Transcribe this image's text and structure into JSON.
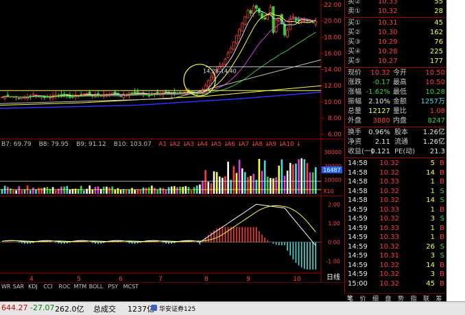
{
  "chart_data": [
    {
      "type": "candlestick",
      "ylim": [
        5.5,
        22.6
      ],
      "y_ticks": [
        "22.00",
        "20.00",
        "18.00",
        "16.00",
        "14.00",
        "12.00",
        "10.00",
        "8.00",
        "6.00"
      ],
      "x_ticks": [
        "4",
        "5",
        "6",
        "7",
        "8",
        "9",
        "10"
      ],
      "annotation": "14.28-14.40"
    },
    {
      "type": "bar",
      "ylim": [
        0,
        32000
      ],
      "y_ticks": [
        "30000",
        "20000",
        "10000"
      ],
      "unit": "X10",
      "current_value": "16487",
      "legend": [
        "B7: 69.79",
        "B8: 79.95",
        "B9: 91.12",
        "B10: 103.07",
        "A1",
        "A2",
        "A3",
        "A4",
        "A5",
        "A6",
        "A7",
        "A8",
        "A9",
        "A10"
      ]
    },
    {
      "type": "line",
      "ylim": [
        -1.6,
        2.3
      ],
      "y_ticks": [
        "2.00",
        "1.00",
        "0.00",
        "-1.00"
      ]
    }
  ],
  "indicator_tabs": [
    "WR",
    "SAR",
    "KDJ",
    "CCI",
    "ROC",
    "MTM",
    "BOLL",
    "PSY",
    "MCST"
  ],
  "period_label": "日线",
  "quote": {
    "sell": [
      {
        "label": "卖②",
        "price": "10.33",
        "vol": "55"
      },
      {
        "label": "卖①",
        "price": "10.32",
        "vol": "28"
      }
    ],
    "buy": [
      {
        "label": "买①",
        "price": "10.31",
        "vol": "45"
      },
      {
        "label": "买②",
        "price": "10.30",
        "vol": "162"
      },
      {
        "label": "买③",
        "price": "10.29",
        "vol": "76"
      },
      {
        "label": "买④",
        "price": "10.28",
        "vol": "225"
      },
      {
        "label": "买⑤",
        "price": "10.27",
        "vol": "177"
      }
    ],
    "stats": [
      {
        "l1": "现价",
        "v1": "10.32",
        "c1": "up",
        "l2": "今开",
        "v2": "10.50",
        "c2": "up"
      },
      {
        "l1": "涨跌",
        "v1": "-0.17",
        "c1": "dn",
        "l2": "最高",
        "v2": "10.50",
        "c2": "up"
      },
      {
        "l1": "涨幅",
        "v1": "-1.62%",
        "c1": "dn",
        "l2": "最低",
        "v2": "10.28",
        "c2": "dn"
      },
      {
        "l1": "振幅",
        "v1": "2.10%",
        "c1": "wh",
        "l2": "金额",
        "v2": "1257万",
        "c2": "cy"
      },
      {
        "l1": "总量",
        "v1": "12127",
        "c1": "yl",
        "l2": "量比",
        "v2": "1.08",
        "c2": "up"
      },
      {
        "l1": "外盘",
        "v1": "3880",
        "c1": "up",
        "l2": "内盘",
        "v2": "8247",
        "c2": "dn"
      }
    ],
    "stats2": [
      {
        "l1": "换手",
        "v1": "0.96%",
        "l2": "股本",
        "v2": "1.26亿"
      },
      {
        "l1": "净资",
        "v1": "2.11",
        "l2": "流通",
        "v2": "1.26亿"
      },
      {
        "l1": "收益(一)",
        "v1": "0.121",
        "l2": "PE(动)",
        "v2": "21.3"
      }
    ]
  },
  "ticks": [
    {
      "time": "14:58",
      "price": "10.32",
      "vol": "5",
      "side": "B"
    },
    {
      "time": "14:58",
      "price": "10.32",
      "vol": "14",
      "side": "B"
    },
    {
      "time": "14:58",
      "price": "10.33",
      "vol": "1",
      "side": "B"
    },
    {
      "time": "14:58",
      "price": "10.32",
      "vol": "1",
      "side": "S"
    },
    {
      "time": "14:58",
      "price": "10.32",
      "vol": "14",
      "side": "S"
    },
    {
      "time": "14:59",
      "price": "10.33",
      "vol": "1",
      "side": "B"
    },
    {
      "time": "14:59",
      "price": "10.32",
      "vol": "3",
      "side": "S"
    },
    {
      "time": "14:59",
      "price": "10.33",
      "vol": "1",
      "side": "B"
    },
    {
      "time": "14:59",
      "price": "10.33",
      "vol": "1",
      "side": "B"
    },
    {
      "time": "14:59",
      "price": "10.32",
      "vol": "26",
      "side": "S"
    },
    {
      "time": "14:59",
      "price": "10.31",
      "vol": "3",
      "side": "S"
    },
    {
      "time": "14:59",
      "price": "10.32",
      "vol": "14",
      "side": "B"
    },
    {
      "time": "14:59",
      "price": "10.32",
      "vol": "3",
      "side": "B"
    },
    {
      "time": "15:00",
      "price": "10.32",
      "vol": "45",
      "side": "B"
    }
  ],
  "right_tabs": [
    "笔",
    "价",
    "细",
    "盘",
    "势",
    "指",
    "联",
    "筹"
  ],
  "status": {
    "index_value": "644.27",
    "index_change": "-27.07",
    "index_amount": "262.0亿",
    "total_label": "总成交",
    "total_value": "1237亿",
    "broker": "华安证券125"
  },
  "colors": {
    "up": "#ff3b3b",
    "down": "#38d038",
    "ma_yellow": "#ffff40",
    "ma_white": "#e0e0e0",
    "ma_purple": "#d040d0",
    "ma_green": "#40c040",
    "ma_blue": "#3030ff"
  }
}
